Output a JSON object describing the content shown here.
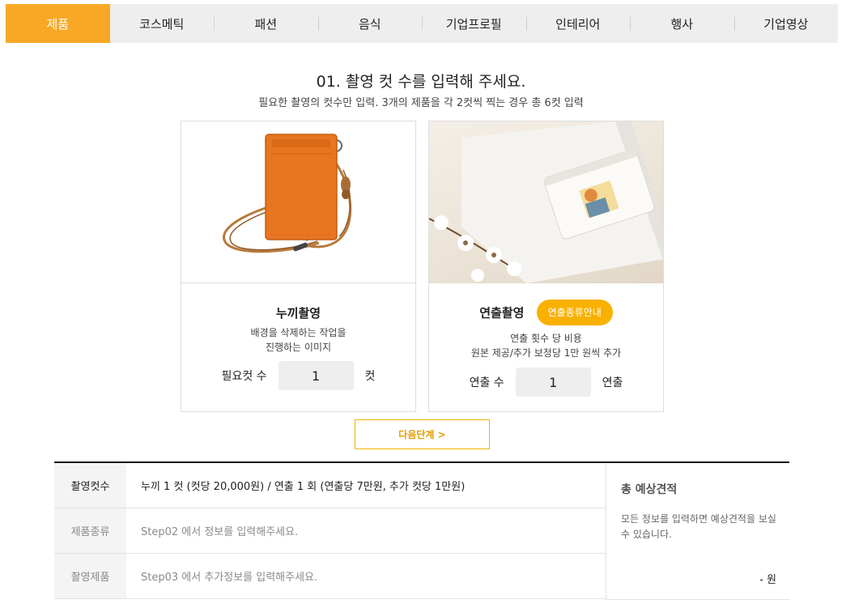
{
  "tabs": [
    {
      "label": "제품",
      "active": true
    },
    {
      "label": "코스메틱"
    },
    {
      "label": "패션"
    },
    {
      "label": "음식"
    },
    {
      "label": "기업프로필"
    },
    {
      "label": "인테리어"
    },
    {
      "label": "행사"
    },
    {
      "label": "기업영상"
    }
  ],
  "heading": {
    "title": "01. 촬영 컷 수를 입력해 주세요.",
    "subtitle": "필요한 촬영의 컷수만 입력. 3개의 제품을 각 2컷씩 찍는 경우 총 6컷 입력"
  },
  "cards": {
    "nukki": {
      "title": "누끼촬영",
      "desc_line1": "배경을 삭제하는 작업을",
      "desc_line2": "진행하는 이미지",
      "count_label": "필요컷 수",
      "count_value": "1",
      "count_unit": "컷"
    },
    "direction": {
      "title": "연출촬영",
      "guide_button": "연출종류안내",
      "desc_line1": "연출 횟수 당 비용",
      "desc_line2": "원본 제공/추가 보정당 1만 원씩 추가",
      "count_label": "연출 수",
      "count_value": "1",
      "count_unit": "연출"
    }
  },
  "next_button": "다음단계 >",
  "summary": {
    "rows": [
      {
        "label": "촬영컷수",
        "value": "누끼 1 컷 (컷당 20,000원) / 연출 1 회 (연출당 7만원, 추가 컷당 1만원)"
      },
      {
        "label": "제품종류",
        "value": "Step02 에서 정보를 입력해주세요."
      },
      {
        "label": "촬영제품",
        "value": "Step03 에서 추가정보를 입력해주세요."
      }
    ],
    "total_title": "총 예상견적",
    "total_desc": "모든 정보를 입력하면 예상견적을 보실 수 있습니다.",
    "total_amount": "- 원"
  },
  "colors": {
    "accent": "#f9a825",
    "pill": "#f9b100",
    "tab_bg": "#eeeeee"
  }
}
